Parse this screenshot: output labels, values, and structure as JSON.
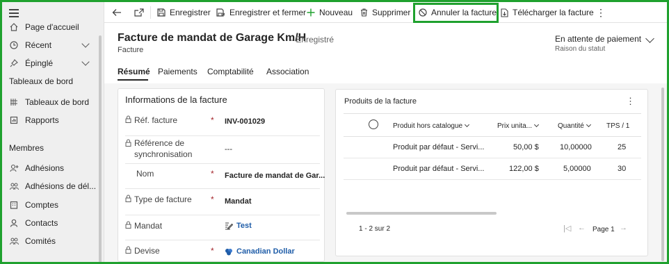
{
  "sidebar": {
    "top_item": "Page d'accueil",
    "recent": "Récent",
    "pinned": "Épinglé",
    "section_dashboards": "Tableaux de bord",
    "dashboards": "Tableaux de bord",
    "reports": "Rapports",
    "section_members": "Membres",
    "adhesions": "Adhésions",
    "adhesions_del": "Adhésions de dél...",
    "accounts": "Comptes",
    "contacts": "Contacts",
    "committees": "Comités"
  },
  "commandbar": {
    "save": "Enregistrer",
    "save_close": "Enregistrer et fermer",
    "new": "Nouveau",
    "delete": "Supprimer",
    "cancel_invoice": "Annuler la facture",
    "download_invoice": "Télécharger la facture"
  },
  "header": {
    "title": "Facture de mandat de Garage Km/H",
    "saved_status": "- Enregistré",
    "entity": "Facture",
    "status_value": "En attente de paiement",
    "status_label": "Raison du statut"
  },
  "tabs": [
    "Résumé",
    "Paiements",
    "Comptabilité",
    "Association"
  ],
  "info": {
    "title": "Informations de la facture",
    "fields": [
      {
        "label": "Réf. facture",
        "value": "INV-001029"
      },
      {
        "label": "Référence de synchronisation",
        "value": "---"
      },
      {
        "label": "Nom",
        "value": "Facture de mandat de Gar..."
      },
      {
        "label": "Type de facture",
        "value": "Mandat"
      },
      {
        "label": "Mandat",
        "value": "Test"
      },
      {
        "label": "Devise",
        "value": "Canadian Dollar"
      }
    ],
    "required_mark": "*"
  },
  "products": {
    "title": "Produits de la facture",
    "columns": [
      "Produit hors catalogue",
      "Prix unita...",
      "Quantité",
      "TPS / 1"
    ],
    "rows": [
      {
        "product": "Produit par défaut - Servi...",
        "price": "50,00 $",
        "qty": "10,00000",
        "tps": "25"
      },
      {
        "product": "Produit par défaut - Servi...",
        "price": "122,00 $",
        "qty": "5,00000",
        "tps": "30"
      }
    ],
    "count_label": "1 - 2 sur 2",
    "page_label": "Page 1"
  },
  "colors": {
    "highlight": "#1fa12e",
    "link": "#1f5da8",
    "required": "#a4262c"
  }
}
